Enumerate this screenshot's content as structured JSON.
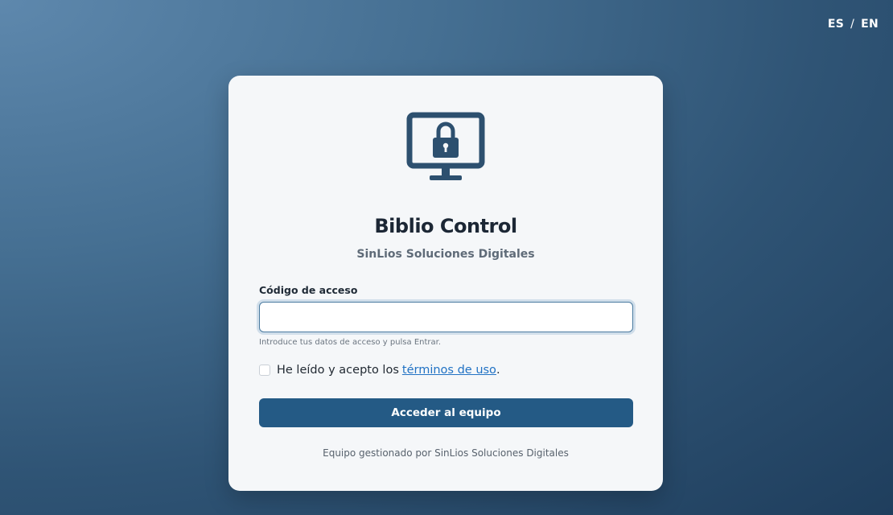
{
  "language_switch": {
    "es": "ES",
    "separator": "/",
    "en": "EN"
  },
  "card": {
    "icon": "monitor-lock-icon",
    "title": "Biblio Control",
    "subtitle": "SinLios Soluciones Digitales"
  },
  "form": {
    "access_code_label": "Código de acceso",
    "access_code_value": "",
    "hint": "Introduce tus datos de acceso y pulsa Entrar.",
    "terms_checked": false,
    "terms_prefix": "He leído y acepto los",
    "terms_link": "términos de uso",
    "terms_suffix": ".",
    "submit_label": "Acceder al equipo"
  },
  "footer": {
    "text": "Equipo gestionado por SinLios Soluciones Digitales"
  },
  "colors": {
    "accent": "#245a85",
    "icon": "#2d506f",
    "link": "#2172c4",
    "background_light": "#5e88ad",
    "background_dark": "#1f3e5d"
  }
}
